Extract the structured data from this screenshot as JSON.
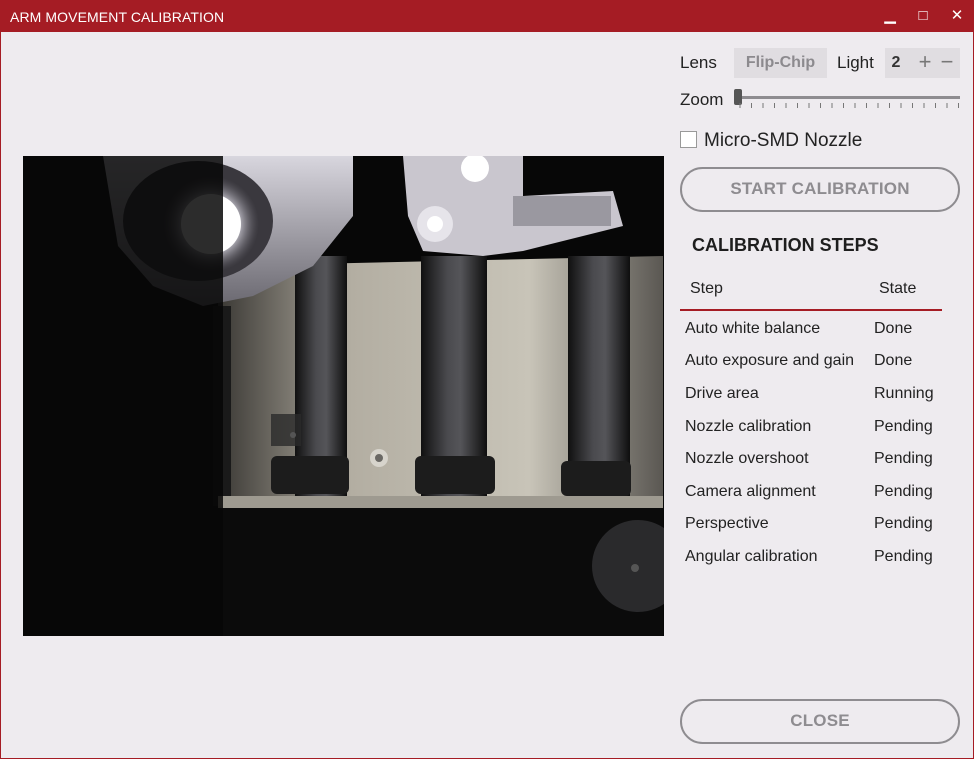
{
  "window": {
    "title": "ARM MOVEMENT CALIBRATION",
    "controls": {
      "minimize": "▁",
      "maximize": "□",
      "close": "✕"
    },
    "accent_color": "#a51c24"
  },
  "controls": {
    "lens_label": "Lens",
    "lens_value": "Flip-Chip",
    "light_label": "Light",
    "light_value": "2",
    "light_plus": "+",
    "light_minus": "−",
    "zoom_label": "Zoom",
    "zoom_level": 0,
    "micro_smd_label": "Micro-SMD Nozzle",
    "micro_smd_checked": false,
    "start_button": "START CALIBRATION"
  },
  "calibration": {
    "title": "CALIBRATION STEPS",
    "col_step": "Step",
    "col_state": "State",
    "steps": [
      {
        "step": "Auto white balance",
        "state": "Done"
      },
      {
        "step": "Auto exposure and gain",
        "state": "Done"
      },
      {
        "step": "Drive area",
        "state": "Running"
      },
      {
        "step": "Nozzle calibration",
        "state": "Pending"
      },
      {
        "step": "Nozzle overshoot",
        "state": "Pending"
      },
      {
        "step": "Camera alignment",
        "state": "Pending"
      },
      {
        "step": "Perspective",
        "state": "Pending"
      },
      {
        "step": "Angular calibration",
        "state": "Pending"
      }
    ]
  },
  "footer": {
    "close_button": "CLOSE"
  }
}
